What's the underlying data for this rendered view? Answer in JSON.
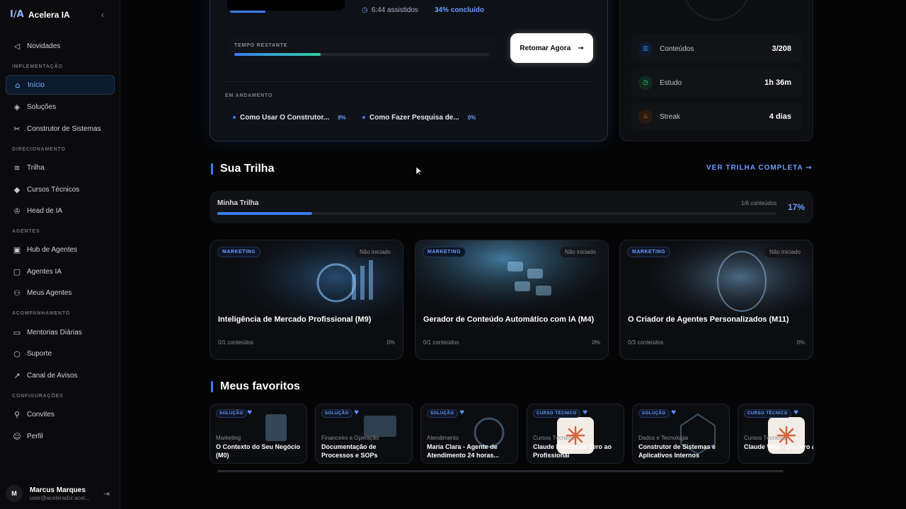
{
  "brand": {
    "name": "Acelera IA"
  },
  "sidebar": {
    "items": [
      {
        "label": "Novidades",
        "icon": "megaphone-icon"
      },
      {
        "label": "Início",
        "icon": "home-icon"
      },
      {
        "label": "Soluções",
        "icon": "layers-icon"
      },
      {
        "label": "Construtor de Sistemas",
        "icon": "tools-icon"
      },
      {
        "label": "Trilha",
        "icon": "route-icon"
      },
      {
        "label": "Cursos Técnicos",
        "icon": "graduation-cap-icon"
      },
      {
        "label": "Head de IA",
        "icon": "crown-icon"
      },
      {
        "label": "Hub de Agentes",
        "icon": "robot-icon"
      },
      {
        "label": "Agentes IA",
        "icon": "bot-icon"
      },
      {
        "label": "Meus Agentes",
        "icon": "users-icon"
      },
      {
        "label": "Mentorias Diárias",
        "icon": "video-icon"
      },
      {
        "label": "Suporte",
        "icon": "chat-icon"
      },
      {
        "label": "Canal de Avisos",
        "icon": "external-link-icon"
      },
      {
        "label": "Convites",
        "icon": "user-plus-icon"
      },
      {
        "label": "Perfil",
        "icon": "user-icon"
      }
    ],
    "sections": [
      "IMPLEMENTAÇÃO",
      "DIRECIONAMENTO",
      "AGENTES",
      "ACOMPANHAMENTO",
      "CONFIGURAÇÕES"
    ]
  },
  "user": {
    "initial": "M",
    "name": "Marcus Marques",
    "email": "user@acelerador.acel..."
  },
  "progress_card": {
    "watched": "6:44 assistidos",
    "completed": "34% concluído",
    "remaining_label": "TEMPO RESTANTE",
    "remaining_fraction": 0.34,
    "resume_label": "Retomar Agora",
    "in_progress_label": "EM ANDAMENTO",
    "chips": [
      {
        "title": "Como Usar O Construtor...",
        "pct": "9%"
      },
      {
        "title": "Como Fazer Pesquisa de...",
        "pct": "0%"
      }
    ]
  },
  "stats": [
    {
      "label": "Conteúdos",
      "value": "3/208",
      "color": "#3c7bf0"
    },
    {
      "label": "Estudo",
      "value": "1h 36m",
      "color": "#2fd08a"
    },
    {
      "label": "Streak",
      "value": "4 dias",
      "color": "#f08a3c"
    }
  ],
  "trail": {
    "title": "Sua Trilha",
    "see_all": "VER TRILHA COMPLETA",
    "name": "Minha Trilha",
    "count": "1/6 conteúdos",
    "pct": "17%",
    "fraction": 0.17
  },
  "courses": [
    {
      "badge": "MARKETING",
      "status": "Não iniciado",
      "title": "Inteligência de Mercado Profissional (M9)",
      "count": "0/1 conteúdos",
      "pct": "0%"
    },
    {
      "badge": "MARKETING",
      "status": "Não iniciado",
      "title": "Gerador de Conteúdo Automático com IA (M4)",
      "count": "0/1 conteúdos",
      "pct": "0%"
    },
    {
      "badge": "MARKETING",
      "status": "Não iniciado",
      "title": "O Criador de Agentes Personalizados (M11)",
      "count": "0/3 conteúdos",
      "pct": "0%"
    }
  ],
  "favorites_title": "Meus favoritos",
  "favorites": [
    {
      "badge": "SOLUÇÃO",
      "category": "Marketing",
      "title": "O Contexto do Seu Negócio (M0)"
    },
    {
      "badge": "SOLUÇÃO",
      "category": "Financeiro e Operação",
      "title": "Documentação de Processos e SOPs"
    },
    {
      "badge": "SOLUÇÃO",
      "category": "Atendimento",
      "title": "Maria Clara - Agente de Atendimento 24 horas..."
    },
    {
      "badge": "CURSO TÉCNICO",
      "category": "Cursos Técnicos",
      "title": "Claude Design do Zero ao Profissional"
    },
    {
      "badge": "SOLUÇÃO",
      "category": "Dados e Tecnologia",
      "title": "Construtor de Sistemas e Aplicativos Internos"
    },
    {
      "badge": "CURSO TÉCNICO",
      "category": "Cursos Técnicos",
      "title": "Claude Web - Do Zero ao Avançado"
    }
  ]
}
